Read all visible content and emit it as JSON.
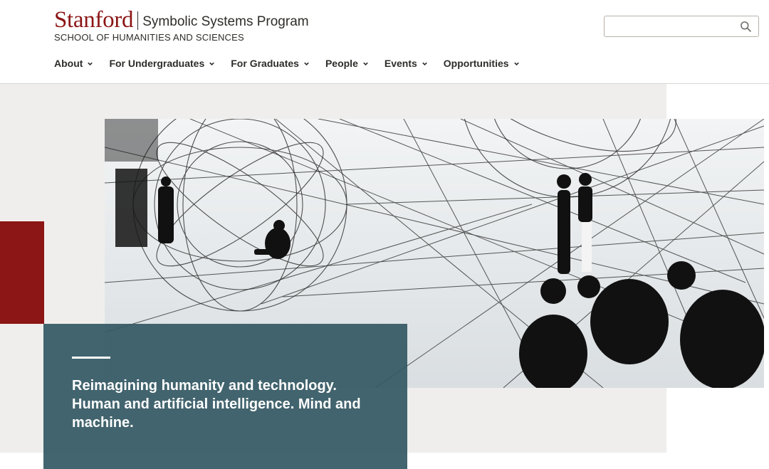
{
  "header": {
    "wordmark": "Stanford",
    "program_name": "Symbolic Systems Program",
    "school_name": "SCHOOL OF HUMANITIES AND SCIENCES",
    "search": {
      "placeholder": "",
      "value": "",
      "icon": "search-icon"
    }
  },
  "nav": {
    "items": [
      {
        "label": "About",
        "icon": "chevron-down-icon"
      },
      {
        "label": "For Undergraduates",
        "icon": "chevron-down-icon"
      },
      {
        "label": "For Graduates",
        "icon": "chevron-down-icon"
      },
      {
        "label": "People",
        "icon": "chevron-down-icon"
      },
      {
        "label": "Events",
        "icon": "chevron-down-icon"
      },
      {
        "label": "Opportunities",
        "icon": "chevron-down-icon"
      }
    ]
  },
  "hero": {
    "tagline": "Reimagining humanity and technology. Human and artificial intelligence. Mind and machine."
  },
  "colors": {
    "cardinal": "#8c1515",
    "teal_card": "#335863",
    "hero_background": "#f0eeec",
    "text": "#2e2d29"
  }
}
